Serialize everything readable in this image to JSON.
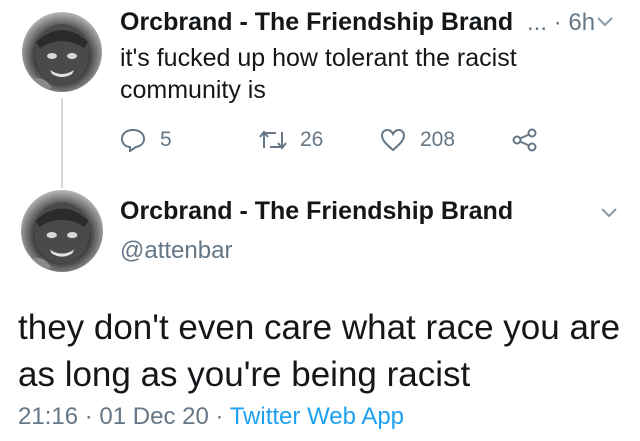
{
  "reply": {
    "author_name": "Orcbrand - The Friendship Brand",
    "truncation": "...",
    "separator": "·",
    "time": "6h",
    "text": "it's fucked up how tolerant the racist community is",
    "replies": "5",
    "retweets": "26",
    "likes": "208"
  },
  "main": {
    "author_name": "Orcbrand - The Friendship Brand",
    "handle": "@attenbar",
    "text": "they don't even care what race you are as long as you're being racist",
    "time": "21:16",
    "dot1": "·",
    "date": "01 Dec 20",
    "dot2": "·",
    "app": "Twitter Web App"
  },
  "icons": {
    "reply": "speech-bubble-icon",
    "retweet": "retweet-icon",
    "like": "heart-icon",
    "share": "share-icon",
    "menu": "chevron-down-icon"
  },
  "colors": {
    "text": "#14171a",
    "secondary": "#657786",
    "link": "#1da1f2"
  }
}
